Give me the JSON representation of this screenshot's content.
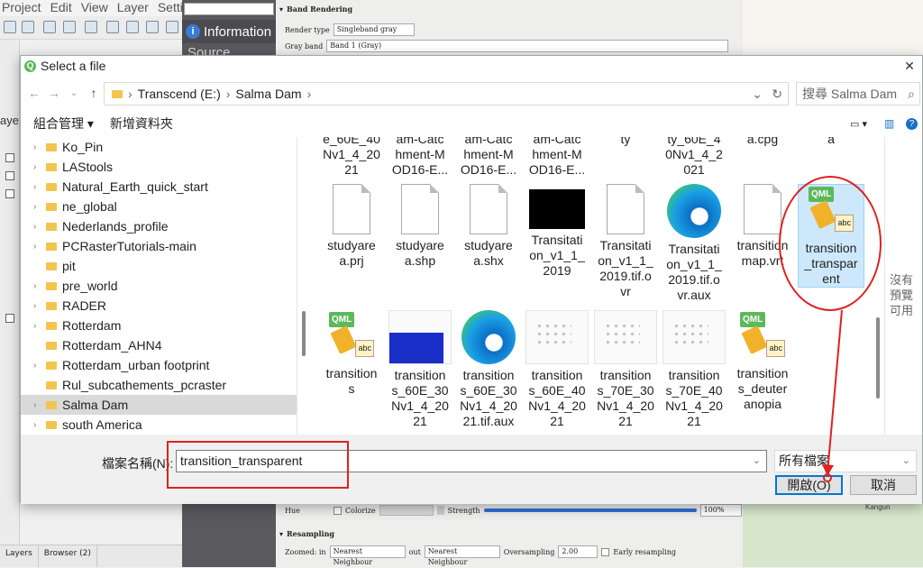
{
  "qgis": {
    "menu": [
      "Project",
      "Edit",
      "View",
      "Layer",
      "Settings"
    ],
    "side_panel_item": "Information",
    "side_panel_next": "Source",
    "left_dock_labels": [
      "ayer"
    ],
    "bottom_tabs": [
      "Layers",
      "Browser (2)"
    ],
    "props": {
      "band_rendering": "Band Rendering",
      "render_type_label": "Render type",
      "render_type_value": "Singleband gray",
      "gray_band_label": "Gray band",
      "gray_band_value": "Band 1 (Gray)",
      "hue_label": "Hue",
      "colorize_label": "Colorize",
      "strength_label": "Strength",
      "strength_value": "100%",
      "resampling_label": "Resampling",
      "zoomed_in_label": "Zoomed: in",
      "zoomed_in_value": "Nearest Neighbour",
      "zoomed_out_label": "out",
      "zoomed_out_value": "Nearest Neighbour",
      "oversampling_label": "Oversampling",
      "oversampling_value": "2.00",
      "early_resampling_label": "Early resampling"
    },
    "map_label": "Kangun"
  },
  "dialog": {
    "title": "Select a file",
    "close_glyph": "✕",
    "nav": {
      "back": "←",
      "forward": "→",
      "down": "⌄",
      "up": "↑"
    },
    "breadcrumb": [
      "Transcend (E:)",
      "Salma Dam"
    ],
    "breadcrumb_sep": "›",
    "address_dropdown": "⌄",
    "refresh": "↻",
    "search_placeholder": "搜尋 Salma Dam",
    "search_icon": "⌕",
    "organize": "組合管理 ▾",
    "new_folder": "新增資料夾",
    "view_icons": [
      "▭ ▾",
      "▥",
      "?"
    ],
    "tree": [
      {
        "label": "Ko_Pin",
        "selected": false,
        "expandable": true
      },
      {
        "label": "LAStools",
        "selected": false,
        "expandable": true
      },
      {
        "label": "Natural_Earth_quick_start",
        "selected": false,
        "expandable": true
      },
      {
        "label": "ne_global",
        "selected": false,
        "expandable": true
      },
      {
        "label": "Nederlands_profile",
        "selected": false,
        "expandable": true
      },
      {
        "label": "PCRasterTutorials-main",
        "selected": false,
        "expandable": true
      },
      {
        "label": "pit",
        "selected": false,
        "expandable": false
      },
      {
        "label": "pre_world",
        "selected": false,
        "expandable": true
      },
      {
        "label": "RADER",
        "selected": false,
        "expandable": true
      },
      {
        "label": "Rotterdam",
        "selected": false,
        "expandable": true
      },
      {
        "label": "Rotterdam_AHN4",
        "selected": false,
        "expandable": false
      },
      {
        "label": "Rotterdam_urban footprint",
        "selected": false,
        "expandable": true
      },
      {
        "label": "Rul_subcathements_pcraster",
        "selected": false,
        "expandable": false
      },
      {
        "label": "Salma Dam",
        "selected": true,
        "expandable": true
      },
      {
        "label": "south America",
        "selected": false,
        "expandable": true
      }
    ],
    "files_row0": [
      "e_60E_40\nNv1_4_20\n21",
      "am-Catc\nhment-M\nOD16-E...",
      "am-Catc\nhment-M\nOD16-E...",
      "am-Catc\nhment-M\nOD16-E...",
      "ty",
      "ty_60E_4\n0Nv1_4_2\n021",
      "a.cpg",
      "a"
    ],
    "files_row1": [
      {
        "label": "studyare\na.prj",
        "icon": "doc"
      },
      {
        "label": "studyare\na.shp",
        "icon": "doc"
      },
      {
        "label": "studyare\na.shx",
        "icon": "doc"
      },
      {
        "label": "Transitati\non_v1_1_\n2019",
        "icon": "black"
      },
      {
        "label": "Transitati\non_v1_1_\n2019.tif.o\nvr",
        "icon": "doc"
      },
      {
        "label": "Transitati\non_v1_1_\n2019.tif.o\nvr.aux",
        "icon": "edge"
      },
      {
        "label": "transition\nmap.vrt",
        "icon": "doc"
      },
      {
        "label": "transition\n_transpar\nent",
        "icon": "qml",
        "selected": true
      }
    ],
    "files_row2": [
      {
        "label": "transition\ns",
        "icon": "qml"
      },
      {
        "label": "transition\ns_60E_30\nNv1_4_20\n21",
        "icon": "blue"
      },
      {
        "label": "transition\ns_60E_30\nNv1_4_20\n21.tif.aux",
        "icon": "edge"
      },
      {
        "label": "transition\ns_60E_40\nNv1_4_20\n21",
        "icon": "dots"
      },
      {
        "label": "transition\ns_70E_30\nNv1_4_20\n21",
        "icon": "dots"
      },
      {
        "label": "transition\ns_70E_40\nNv1_4_20\n21",
        "icon": "dots"
      },
      {
        "label": "transition\ns_deuter\nanopia",
        "icon": "qml"
      }
    ],
    "qml_tag": "QML",
    "abc_tag": "abc",
    "preview_text": "沒有預覽可用",
    "filename_label": "檔案名稱(N):",
    "filename_value": "transition_transparent",
    "filetype": "所有檔案",
    "filetype_arrow": "⌄",
    "open_button": "開啟(O)",
    "cancel_button": "取消"
  }
}
